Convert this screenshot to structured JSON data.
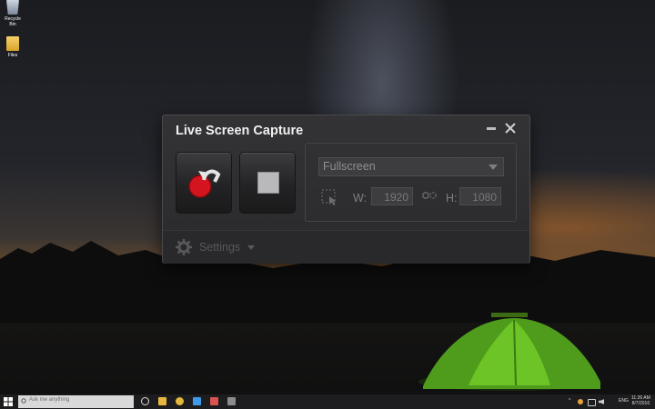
{
  "desktop": {
    "icons": [
      {
        "label": "Recycle Bin",
        "icon": "recycle-bin-icon"
      },
      {
        "label": "Files",
        "icon": "folder-icon"
      }
    ]
  },
  "window": {
    "title": "Live Screen Capture",
    "minimize_icon": "minimize-icon",
    "close_icon": "close-icon",
    "record_button_icon": "record-icon",
    "stop_button_icon": "stop-icon",
    "capture_mode": {
      "selected": "Fullscreen"
    },
    "width_label": "W:",
    "width_value": "1920",
    "height_label": "H:",
    "height_value": "1080",
    "settings_label": "Settings",
    "colors": {
      "record": "#d4141e",
      "window_bg": "#2e2e30"
    }
  },
  "taskbar": {
    "search_placeholder": "Ask me anything",
    "tray_lang": "ENG",
    "clock_time": "11:26 AM",
    "clock_date": "8/7/2016",
    "icons": [
      "start-icon",
      "task-view-icon",
      "file-explorer-icon",
      "chrome-icon",
      "store-icon",
      "photos-icon",
      "app-icon"
    ]
  }
}
